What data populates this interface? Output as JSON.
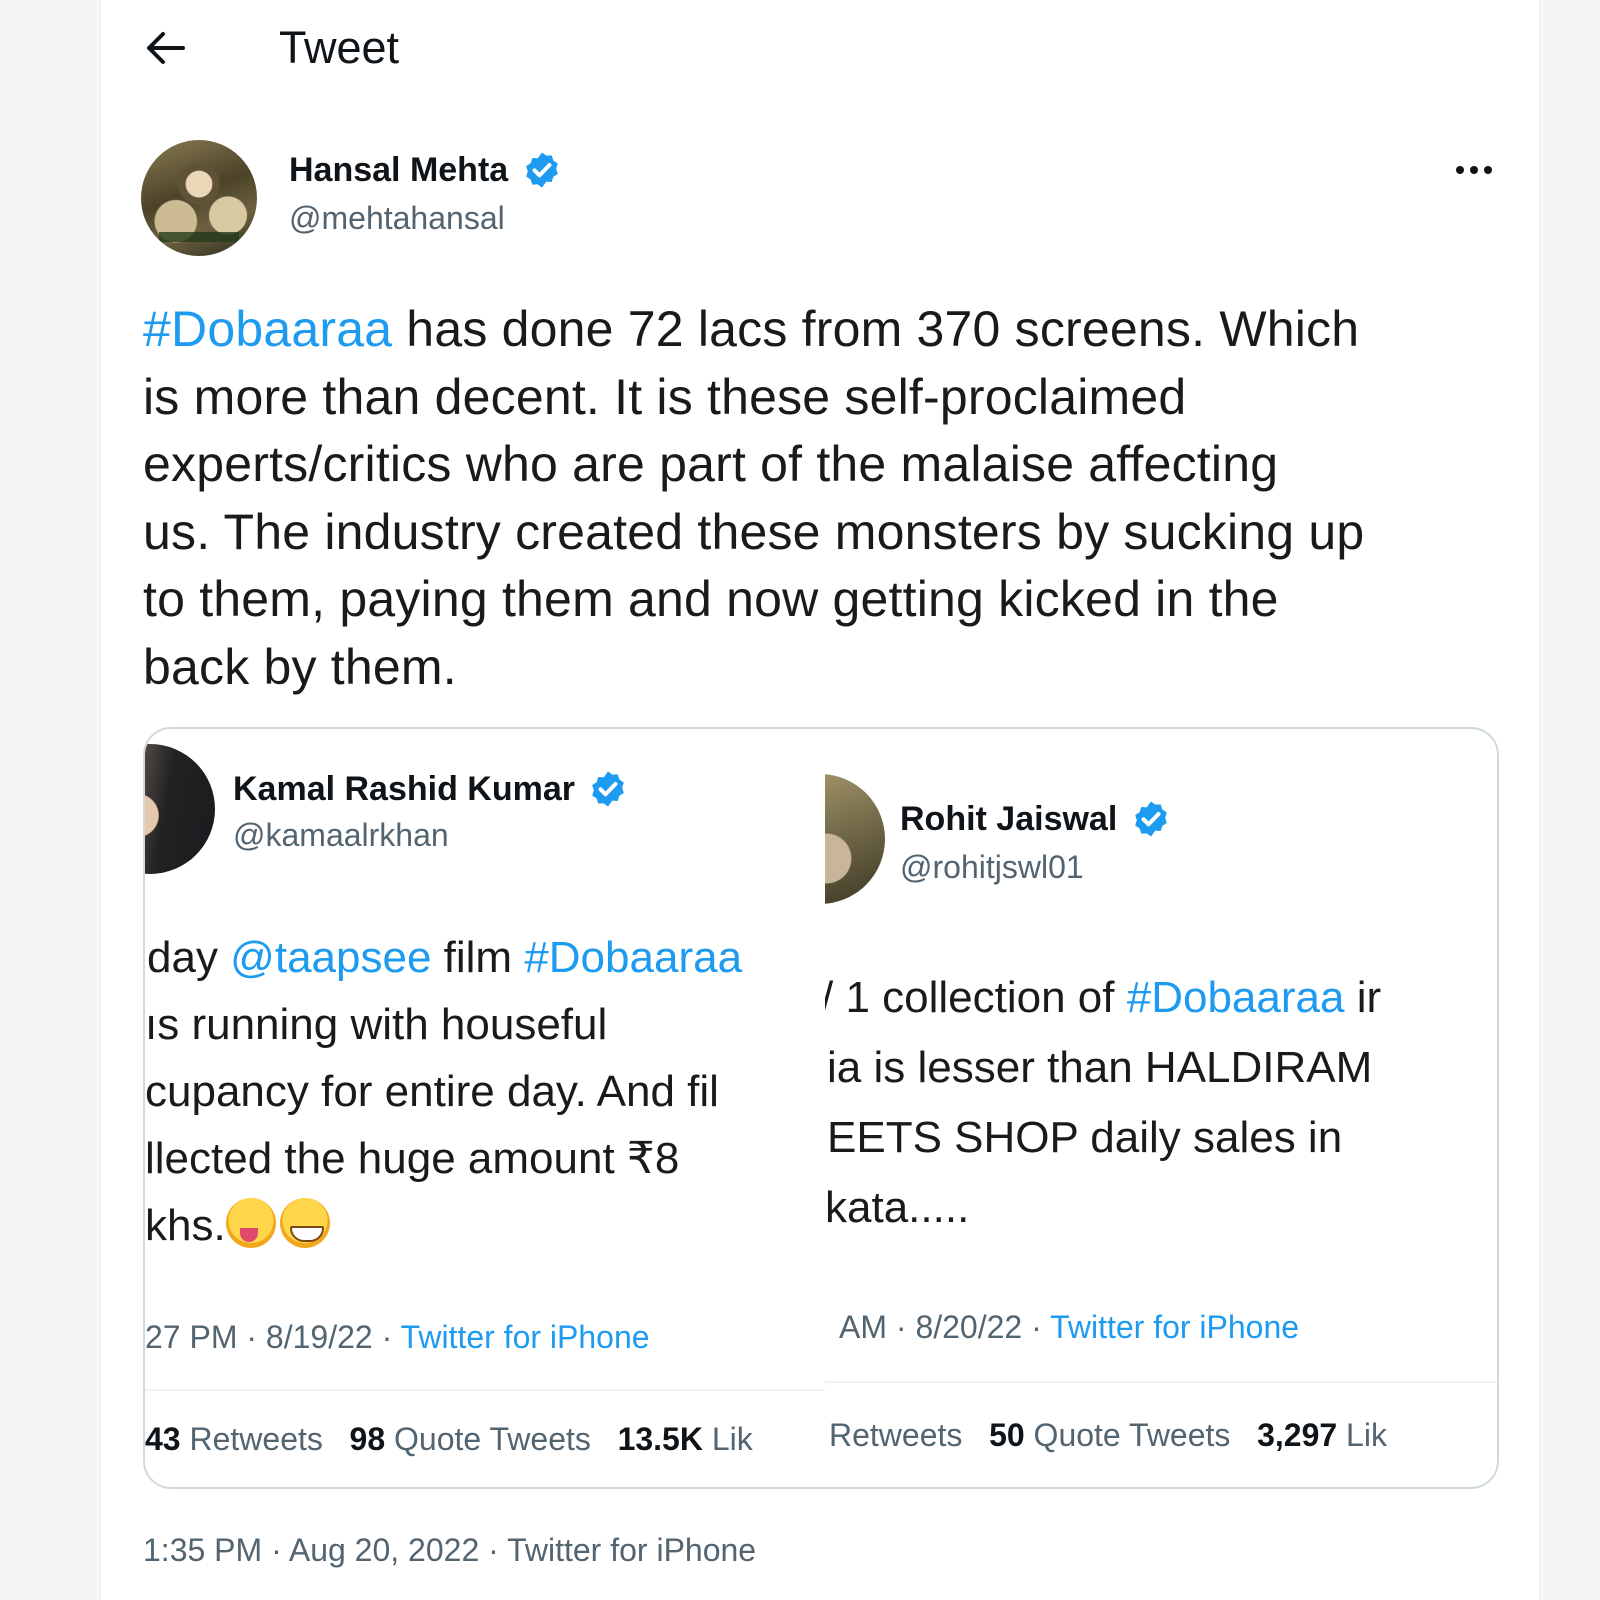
{
  "header": {
    "title": "Tweet",
    "back_icon": "arrow-left-icon"
  },
  "tweet": {
    "author": {
      "name": "Hansal Mehta",
      "handle": "@mehtahansal",
      "verified": true
    },
    "text": {
      "hashtag": "#Dobaaraa",
      "lines": [
        " has done 72 lacs from 370 screens. Which",
        "is more than decent. It is these self-proclaimed",
        "experts/critics who are part of the malaise affecting",
        "us. The industry created these monsters by sucking up",
        "to them, paying them and now getting kicked in the",
        "back by them."
      ]
    },
    "footer": "1:35 PM · Aug 20, 2022 · Twitter for iPhone"
  },
  "quoted": [
    {
      "author": {
        "name": "Kamal Rashid Kumar",
        "handle": "@kamaalrkhan",
        "verified": true
      },
      "line1": {
        "pre": "day ",
        "mention": "@taapsee",
        "mid": " film ",
        "hashtag": "#Dobaaraa"
      },
      "lines": [
        "ıs running with houseful",
        "cupancy for entire day. And fil",
        "llected the huge amount ₹8",
        "khs."
      ],
      "emojis": [
        "zany-face-emoji",
        "grinning-face-emoji"
      ],
      "meta": {
        "time": "27 PM · 8/19/22 · ",
        "source": "Twitter for iPhone"
      },
      "stats": {
        "retweets": "43",
        "retweets_label": " Retweets",
        "quotes": "98",
        "quotes_label": " Quote Tweets",
        "likes": "13.5K",
        "likes_label": " Lik"
      }
    },
    {
      "author": {
        "name": "Rohit Jaiswal",
        "handle": "@rohitjswl01",
        "verified": true
      },
      "line1": {
        "pre": "/ 1 collection of ",
        "hashtag": "#Dobaaraa",
        "post": " ir"
      },
      "lines": [
        "ia is lesser than HALDIRAM",
        "EETS SHOP daily sales in",
        "kata....."
      ],
      "meta": {
        "time": "AM · 8/20/22 · ",
        "source": "Twitter for iPhone"
      },
      "stats": {
        "retweets_label": "Retweets",
        "quotes": "50",
        "quotes_label": " Quote Tweets",
        "likes": "3,297",
        "likes_label": " Lik"
      }
    }
  ],
  "colors": {
    "accent": "#1d9bf0",
    "secondary_text": "#536471",
    "border": "#cfd9de"
  }
}
